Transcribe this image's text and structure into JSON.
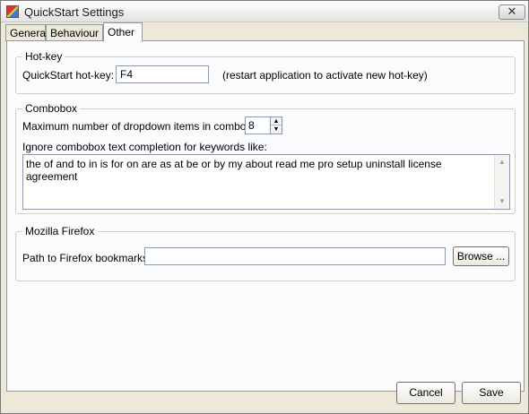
{
  "window": {
    "title": "QuickStart Settings",
    "close_glyph": "✕"
  },
  "tabs": [
    {
      "label": "General"
    },
    {
      "label": "Behaviour"
    },
    {
      "label": "Other"
    }
  ],
  "hotkey": {
    "group_title": "Hot-key",
    "label": "QuickStart hot-key:",
    "value": "F4",
    "hint": "(restart application to activate new hot-key)"
  },
  "combobox": {
    "group_title": "Combobox",
    "max_items_label": "Maximum number of dropdown items in combobox:",
    "max_items_value": "8",
    "ignore_label": "Ignore combobox text completion for keywords like:",
    "keywords": "the of and to in is for on are as at be or by my about read me pro setup uninstall license agreement"
  },
  "firefox": {
    "group_title": "Mozilla Firefox",
    "path_label": "Path to Firefox bookmarks:",
    "path_value": "",
    "browse_label": "Browse ..."
  },
  "buttons": {
    "cancel": "Cancel",
    "save": "Save"
  },
  "icons": {
    "window": "app-icon",
    "close": "close-icon",
    "spin_up": "spin-up-arrow-icon",
    "spin_down": "spin-down-arrow-icon",
    "scroll_up": "scroll-up-arrow-icon",
    "scroll_down": "scroll-down-arrow-icon"
  }
}
